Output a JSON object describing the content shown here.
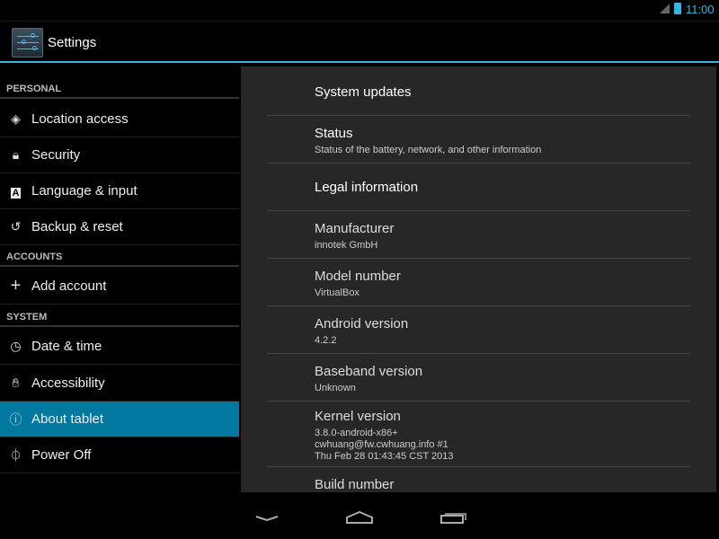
{
  "status_bar": {
    "time": "11:00",
    "icons": [
      "signal-icon",
      "battery-icon"
    ]
  },
  "action_bar": {
    "title": "Settings",
    "icon": "settings-sliders-icon"
  },
  "sidebar": {
    "headers": {
      "personal": "PERSONAL",
      "accounts": "ACCOUNTS",
      "system": "SYSTEM"
    },
    "items": [
      {
        "label": "Location access",
        "icon": "location-icon"
      },
      {
        "label": "Security",
        "icon": "lock-icon"
      },
      {
        "label": "Language & input",
        "icon": "keyboard-a-icon"
      },
      {
        "label": "Backup & reset",
        "icon": "restore-icon"
      },
      {
        "label": "Add account",
        "icon": "plus-icon"
      },
      {
        "label": "Date & time",
        "icon": "clock-icon"
      },
      {
        "label": "Accessibility",
        "icon": "hand-icon"
      },
      {
        "label": "About tablet",
        "icon": "info-icon",
        "selected": true
      },
      {
        "label": "Power Off",
        "icon": "power-icon"
      }
    ],
    "selected_color": "#0078a0"
  },
  "about": {
    "system_updates": "System updates",
    "status": {
      "title": "Status",
      "summary": "Status of the battery, network, and other information"
    },
    "legal": "Legal information",
    "manufacturer": {
      "title": "Manufacturer",
      "value": "innotek GmbH"
    },
    "model": {
      "title": "Model number",
      "value": "VirtualBox"
    },
    "android": {
      "title": "Android version",
      "value": "4.2.2"
    },
    "baseband": {
      "title": "Baseband version",
      "value": "Unknown"
    },
    "kernel": {
      "title": "Kernel version",
      "line1": "3.8.0-android-x86+",
      "line2": "cwhuang@fw.cwhuang.info #1",
      "line3": "Thu Feb 28 01:43:45 CST 2013"
    },
    "build": {
      "title": "Build number"
    }
  },
  "nav_bar": {
    "buttons": [
      "back-icon",
      "home-icon",
      "recents-icon"
    ]
  },
  "accent": "#33b5e5"
}
